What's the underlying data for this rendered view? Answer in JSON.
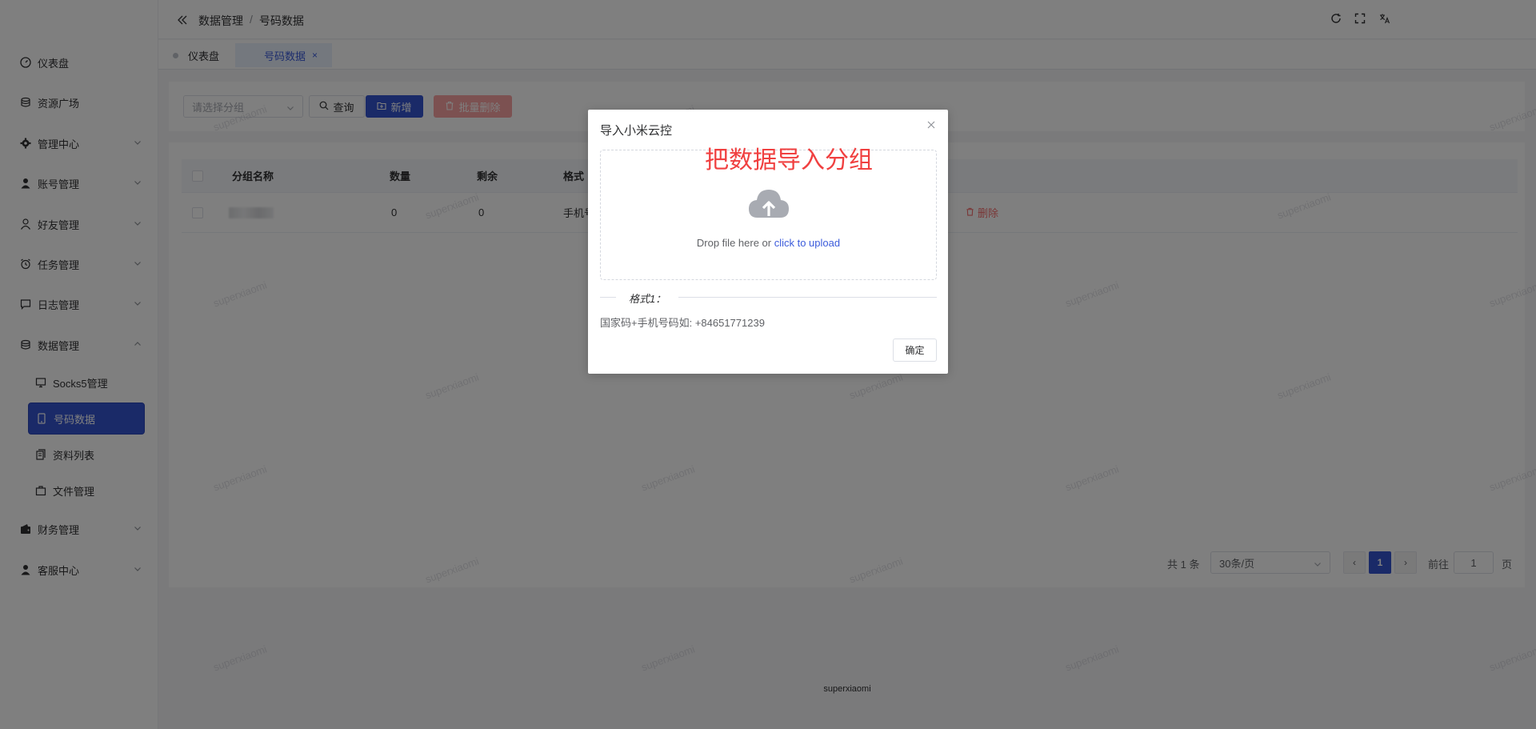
{
  "sidebar": {
    "items": [
      {
        "label": "仪表盘",
        "icon": "dashboard-icon"
      },
      {
        "label": "资源广场",
        "icon": "database-icon"
      },
      {
        "label": "管理中心",
        "icon": "gear-icon"
      },
      {
        "label": "账号管理",
        "icon": "user-filled-icon"
      },
      {
        "label": "好友管理",
        "icon": "user-icon"
      },
      {
        "label": "任务管理",
        "icon": "alarm-clock-icon"
      },
      {
        "label": "日志管理",
        "icon": "chat-icon"
      },
      {
        "label": "数据管理",
        "icon": "database-icon"
      },
      {
        "label": "财务管理",
        "icon": "wallet-icon"
      },
      {
        "label": "客服中心",
        "icon": "user-filled-icon"
      }
    ],
    "sub_items": [
      {
        "label": "Socks5管理",
        "icon": "monitor-icon"
      },
      {
        "label": "号码数据",
        "icon": "phone-icon"
      },
      {
        "label": "资料列表",
        "icon": "document-copy-icon"
      },
      {
        "label": "文件管理",
        "icon": "briefcase-icon"
      }
    ]
  },
  "header": {
    "breadcrumb": [
      "数据管理",
      "号码数据"
    ],
    "separator": "/"
  },
  "tabs": [
    {
      "label": "仪表盘"
    },
    {
      "label": "号码数据",
      "close": "×"
    }
  ],
  "toolbar": {
    "group_select_placeholder": "请选择分组",
    "query_label": "查询",
    "add_label": "新增",
    "batch_delete_label": "批量删除"
  },
  "table": {
    "headers": [
      "分组名称",
      "数量",
      "剩余",
      "格式"
    ],
    "rows": [
      {
        "quantity": "0",
        "remaining": "0",
        "format": "手机号",
        "delete_label": "删除"
      }
    ]
  },
  "pagination": {
    "total": "共 1 条",
    "page_size": "30条/页",
    "prev": "‹",
    "current": "1",
    "next": "›",
    "goto_label": "前往",
    "goto_value": "1",
    "page_unit": "页"
  },
  "footer": "superxiaomi",
  "watermark": "superxiaomi",
  "dialog": {
    "title": "导入小米云控",
    "annotation": "把数据导入分组",
    "drop_text": "Drop file here or ",
    "upload_link": "click to upload",
    "format_label": "格式1：",
    "format_text": "国家码+手机号码如: +84651771239",
    "confirm_label": "确定"
  }
}
